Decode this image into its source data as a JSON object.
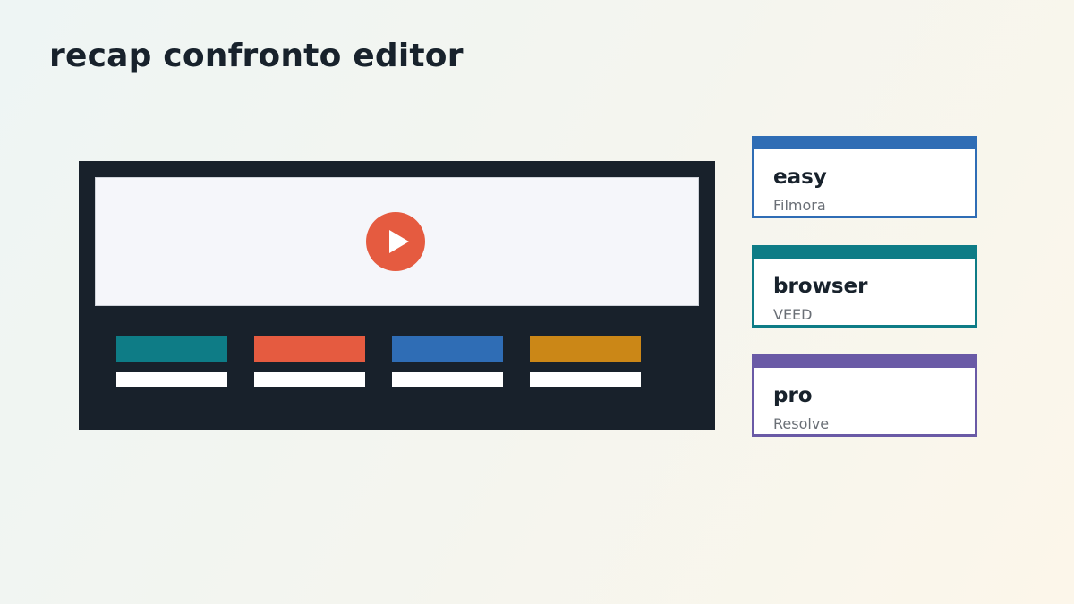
{
  "title": "recap confronto editor",
  "editor": {
    "play_icon": "play-icon",
    "play_color": "#e55b40",
    "tracks": [
      {
        "color": "#0e7c86"
      },
      {
        "color": "#e55b40"
      },
      {
        "color": "#2f6db5"
      },
      {
        "color": "#cb8717"
      }
    ]
  },
  "cards": [
    {
      "title": "easy",
      "subtitle": "Filmora",
      "accent": "#2f6db5"
    },
    {
      "title": "browser",
      "subtitle": "VEED",
      "accent": "#0e7c86"
    },
    {
      "title": "pro",
      "subtitle": "Resolve",
      "accent": "#6a5aa6"
    }
  ]
}
